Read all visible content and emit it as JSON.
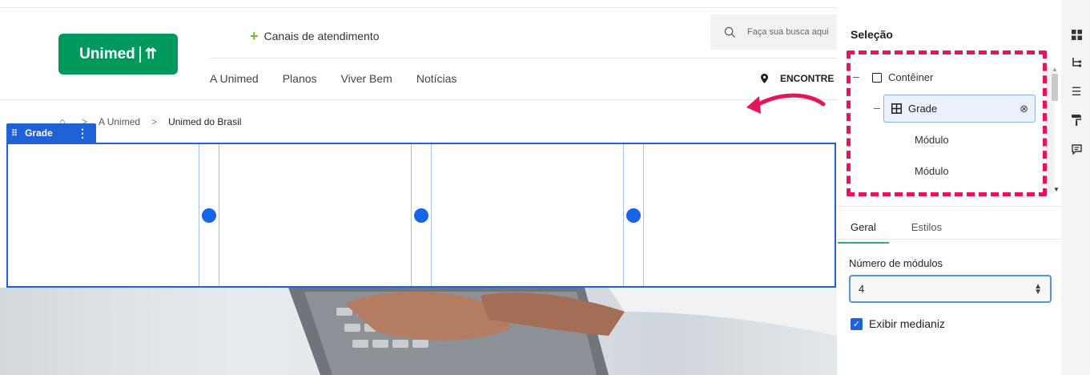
{
  "header": {
    "logo_text": "Unimed",
    "canais": "Canais de atendimento",
    "search_placeholder": "Faça sua busca aqui",
    "nav": [
      "A Unimed",
      "Planos",
      "Viver Bem",
      "Notícias"
    ],
    "encontre": "ENCONTRE"
  },
  "breadcrumb": {
    "items": [
      "A Unimed",
      "Unimed do Brasil"
    ],
    "separator": ">"
  },
  "grade": {
    "tag_label": "Grade",
    "modules": 4
  },
  "panel": {
    "title": "Seleção",
    "tree": {
      "container": "Contêiner",
      "grade": "Grade",
      "modules": [
        "Módulo",
        "Módulo"
      ]
    },
    "tabs": [
      "Geral",
      "Estilos"
    ],
    "active_tab": "Geral",
    "field_label": "Número de módulos",
    "field_value": "4",
    "checkbox_label": "Exibir medianiz",
    "checkbox_checked": true
  },
  "colors": {
    "brand_green": "#00995d",
    "selection_blue": "#1e62d6",
    "annotation_red": "#e8135a"
  }
}
